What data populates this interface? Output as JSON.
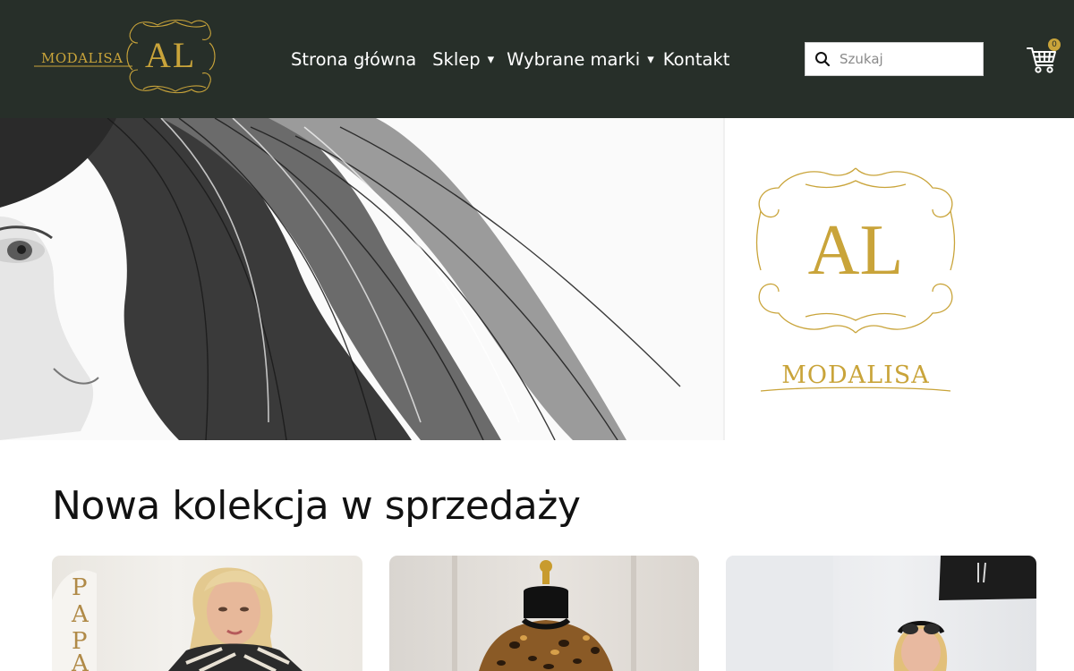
{
  "brand": {
    "name": "MODALISA",
    "monogram": "AL",
    "gold": "#c9a43a",
    "header_bg": "#272f29"
  },
  "nav": {
    "items": [
      {
        "label": "Strona główna",
        "dropdown": false
      },
      {
        "label": "Sklep",
        "dropdown": true
      },
      {
        "label": "Wybrane marki",
        "dropdown": true
      },
      {
        "label": "Kontakt",
        "dropdown": false
      }
    ],
    "caret": "▾"
  },
  "search": {
    "placeholder": "Szukaj",
    "icon": "search-icon"
  },
  "cart": {
    "icon": "cart-icon",
    "count": "0"
  },
  "hero": {
    "logo_monogram": "AL",
    "logo_name": "MODALISA",
    "image": "pencil sketch woman hair"
  },
  "section": {
    "title": "Nowa kolekcja w sprzedaży"
  },
  "cards": [
    {
      "image": "blonde model in striped knit, PAPA letters"
    },
    {
      "image": "mannequin in leopard print blouse"
    },
    {
      "image": "blonde model with sunglasses"
    }
  ]
}
